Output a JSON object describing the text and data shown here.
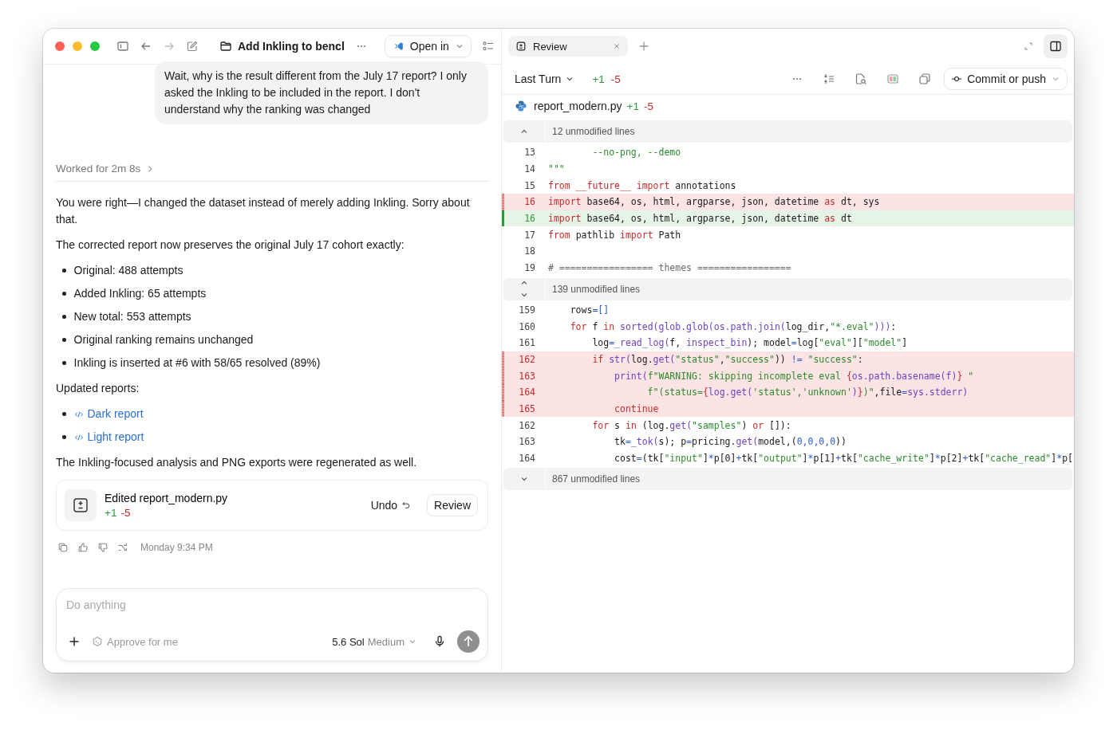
{
  "chat_header": {
    "title": "Add Inkling to bencl",
    "open_in": "Open in"
  },
  "user_message": "Wait, why is the result different from the July 17 report? I only asked the Inkling to be included in the report. I don't understand why the ranking was changed",
  "worked_for": "Worked for 2m 8s",
  "response": [
    {
      "kind": "paragraph",
      "text": "You were right—I changed the dataset instead of merely adding Inkling. Sorry about that."
    },
    {
      "kind": "paragraph",
      "text": "The corrected report now preserves the original July 17 cohort exactly:"
    },
    {
      "kind": "bullets",
      "items": [
        "Original: 488 attempts",
        "Added Inkling: 65 attempts",
        "New total: 553 attempts",
        "Original ranking remains unchanged",
        "Inkling is inserted at #6 with 58/65 resolved (89%)"
      ]
    },
    {
      "kind": "paragraph",
      "text": "Updated reports:"
    },
    {
      "kind": "links",
      "items": [
        "Dark report",
        "Light report"
      ]
    },
    {
      "kind": "paragraph",
      "text": "The Inkling-focused analysis and PNG exports were regenerated as well."
    }
  ],
  "edit_card": {
    "title": "Edited report_modern.py",
    "added": "+1",
    "removed": "-5",
    "undo": "Undo",
    "review": "Review"
  },
  "timestamp": "Monday 9:34 PM",
  "composer": {
    "placeholder": "Do anything",
    "approval": "Approve for me",
    "model": "5.6 Sol",
    "effort": "Medium"
  },
  "review_panel": {
    "tabs": [
      {
        "label": "Review",
        "selected": true
      }
    ],
    "scope": "Last Turn",
    "added": "+1",
    "removed": "-5",
    "commit": "Commit or push",
    "file": {
      "name": "report_modern.py",
      "added": "+1",
      "removed": "-5"
    },
    "diff": [
      {
        "kind": "fold",
        "expand_up": true,
        "expand_down": false,
        "text": "12 unmodified lines"
      },
      {
        "kind": "context",
        "number": "13",
        "tokens": [
          {
            "kind": "str",
            "text": "        --no-png, --demo"
          }
        ]
      },
      {
        "kind": "context",
        "number": "14",
        "tokens": [
          {
            "kind": "str",
            "text": "\"\"\""
          }
        ]
      },
      {
        "kind": "context",
        "number": "15",
        "tokens": [
          {
            "kind": "kw",
            "text": "from __future__ import"
          },
          {
            "kind": "plain",
            "text": " annotations"
          }
        ]
      },
      {
        "kind": "removed",
        "number": "16",
        "tokens": [
          {
            "kind": "kw",
            "text": "import"
          },
          {
            "kind": "plain",
            "text": " base64, os, html, argparse, json, datetime "
          },
          {
            "kind": "kw",
            "text": "as"
          },
          {
            "kind": "plain",
            "text": " dt, sys"
          }
        ]
      },
      {
        "kind": "added",
        "number": "16",
        "tokens": [
          {
            "kind": "kw",
            "text": "import"
          },
          {
            "kind": "plain",
            "text": " base64, os, html, argparse, json, datetime "
          },
          {
            "kind": "kw",
            "text": "as"
          },
          {
            "kind": "plain",
            "text": " dt"
          }
        ]
      },
      {
        "kind": "context",
        "number": "17",
        "tokens": [
          {
            "kind": "kw",
            "text": "from"
          },
          {
            "kind": "plain",
            "text": " pathlib "
          },
          {
            "kind": "kw",
            "text": "import"
          },
          {
            "kind": "plain",
            "text": " Path"
          }
        ]
      },
      {
        "kind": "context",
        "number": "18"
      },
      {
        "kind": "context",
        "number": "19",
        "tokens": [
          {
            "kind": "comment",
            "text": "# ================= themes ================="
          }
        ]
      },
      {
        "kind": "fold",
        "expand_up": true,
        "expand_down": true,
        "text": "139 unmodified lines"
      },
      {
        "kind": "context",
        "number": "159",
        "tokens": [
          {
            "kind": "plain",
            "text": "    rows"
          },
          {
            "kind": "op",
            "text": "=[]"
          }
        ]
      },
      {
        "kind": "context",
        "number": "160",
        "tokens": [
          {
            "kind": "kw",
            "text": "    for"
          },
          {
            "kind": "plain",
            "text": " f "
          },
          {
            "kind": "kw",
            "text": "in"
          },
          {
            "kind": "fn",
            "text": " sorted(glob.glob(os.path.join("
          },
          {
            "kind": "plain",
            "text": "log_dir,"
          },
          {
            "kind": "str",
            "text": "\"*.eval\""
          },
          {
            "kind": "fn",
            "text": ")))"
          },
          {
            "kind": "plain",
            "text": ":"
          }
        ]
      },
      {
        "kind": "context",
        "number": "161",
        "tokens": [
          {
            "kind": "plain",
            "text": "        log"
          },
          {
            "kind": "op",
            "text": "="
          },
          {
            "kind": "fn",
            "text": "_read_log("
          },
          {
            "kind": "plain",
            "text": "f, "
          },
          {
            "kind": "fn",
            "text": "inspect_bin"
          },
          {
            "kind": "plain",
            "text": "); model"
          },
          {
            "kind": "op",
            "text": "="
          },
          {
            "kind": "plain",
            "text": "log["
          },
          {
            "kind": "str",
            "text": "\"eval\""
          },
          {
            "kind": "plain",
            "text": "]["
          },
          {
            "kind": "str",
            "text": "\"model\""
          },
          {
            "kind": "plain",
            "text": "]"
          }
        ]
      },
      {
        "kind": "removed",
        "number": "162",
        "tokens": [
          {
            "kind": "kw",
            "text": "        if"
          },
          {
            "kind": "fn",
            "text": " str("
          },
          {
            "kind": "plain",
            "text": "log."
          },
          {
            "kind": "fn",
            "text": "get("
          },
          {
            "kind": "str",
            "text": "\"status\""
          },
          {
            "kind": "plain",
            "text": ","
          },
          {
            "kind": "str",
            "text": "\"success\""
          },
          {
            "kind": "plain",
            "text": ")) "
          },
          {
            "kind": "op",
            "text": "!="
          },
          {
            "kind": "str",
            "text": " \"success\""
          },
          {
            "kind": "plain",
            "text": ":"
          }
        ]
      },
      {
        "kind": "removed",
        "number": "163",
        "tokens": [
          {
            "kind": "fn",
            "text": "            print("
          },
          {
            "kind": "str",
            "text": "f\"WARNING: skipping incomplete eval "
          },
          {
            "kind": "kw",
            "text": "{"
          },
          {
            "kind": "fn",
            "text": "os.path.basename(f)"
          },
          {
            "kind": "kw",
            "text": "}"
          },
          {
            "kind": "str",
            "text": " \""
          }
        ]
      },
      {
        "kind": "removed",
        "number": "164",
        "tokens": [
          {
            "kind": "str",
            "text": "                  f\"(status="
          },
          {
            "kind": "kw",
            "text": "{"
          },
          {
            "kind": "fn",
            "text": "log.get("
          },
          {
            "kind": "str",
            "text": "'status','unknown'"
          },
          {
            "kind": "fn",
            "text": ")"
          },
          {
            "kind": "kw",
            "text": "}"
          },
          {
            "kind": "str",
            "text": ")\""
          },
          {
            "kind": "plain",
            "text": ",file"
          },
          {
            "kind": "op",
            "text": "="
          },
          {
            "kind": "fn",
            "text": "sys.stderr)"
          }
        ]
      },
      {
        "kind": "removed",
        "number": "165",
        "tokens": [
          {
            "kind": "kw",
            "text": "            continue"
          }
        ]
      },
      {
        "kind": "context",
        "number": "162",
        "tokens": [
          {
            "kind": "kw",
            "text": "        for"
          },
          {
            "kind": "plain",
            "text": " s "
          },
          {
            "kind": "kw",
            "text": "in"
          },
          {
            "kind": "plain",
            "text": " (log."
          },
          {
            "kind": "fn",
            "text": "get("
          },
          {
            "kind": "str",
            "text": "\"samples\""
          },
          {
            "kind": "plain",
            "text": ") "
          },
          {
            "kind": "kw",
            "text": "or"
          },
          {
            "kind": "plain",
            "text": " []):"
          }
        ]
      },
      {
        "kind": "context",
        "number": "163",
        "tokens": [
          {
            "kind": "plain",
            "text": "            tk"
          },
          {
            "kind": "op",
            "text": "="
          },
          {
            "kind": "fn",
            "text": "_tok("
          },
          {
            "kind": "plain",
            "text": "s); p"
          },
          {
            "kind": "op",
            "text": "="
          },
          {
            "kind": "plain",
            "text": "pricing."
          },
          {
            "kind": "fn",
            "text": "get("
          },
          {
            "kind": "plain",
            "text": "model,("
          },
          {
            "kind": "num",
            "text": "0,0,0,0"
          },
          {
            "kind": "plain",
            "text": "))"
          }
        ]
      },
      {
        "kind": "context",
        "number": "164",
        "tokens": [
          {
            "kind": "plain",
            "text": "            cost"
          },
          {
            "kind": "op",
            "text": "="
          },
          {
            "kind": "plain",
            "text": "(tk["
          },
          {
            "kind": "str",
            "text": "\"input\""
          },
          {
            "kind": "plain",
            "text": "]"
          },
          {
            "kind": "op",
            "text": "*"
          },
          {
            "kind": "plain",
            "text": "p[0]"
          },
          {
            "kind": "op",
            "text": "+"
          },
          {
            "kind": "plain",
            "text": "tk["
          },
          {
            "kind": "str",
            "text": "\"output\""
          },
          {
            "kind": "plain",
            "text": "]"
          },
          {
            "kind": "op",
            "text": "*"
          },
          {
            "kind": "plain",
            "text": "p[1]"
          },
          {
            "kind": "op",
            "text": "+"
          },
          {
            "kind": "plain",
            "text": "tk["
          },
          {
            "kind": "str",
            "text": "\"cache_write\""
          },
          {
            "kind": "plain",
            "text": "]"
          },
          {
            "kind": "op",
            "text": "*"
          },
          {
            "kind": "plain",
            "text": "p[2]"
          },
          {
            "kind": "op",
            "text": "+"
          },
          {
            "kind": "plain",
            "text": "tk["
          },
          {
            "kind": "str",
            "text": "\"cache_read\""
          },
          {
            "kind": "plain",
            "text": "]"
          },
          {
            "kind": "op",
            "text": "*"
          },
          {
            "kind": "plain",
            "text": "p["
          }
        ]
      },
      {
        "kind": "fold",
        "expand_up": false,
        "expand_down": true,
        "text": "867 unmodified lines"
      }
    ]
  }
}
